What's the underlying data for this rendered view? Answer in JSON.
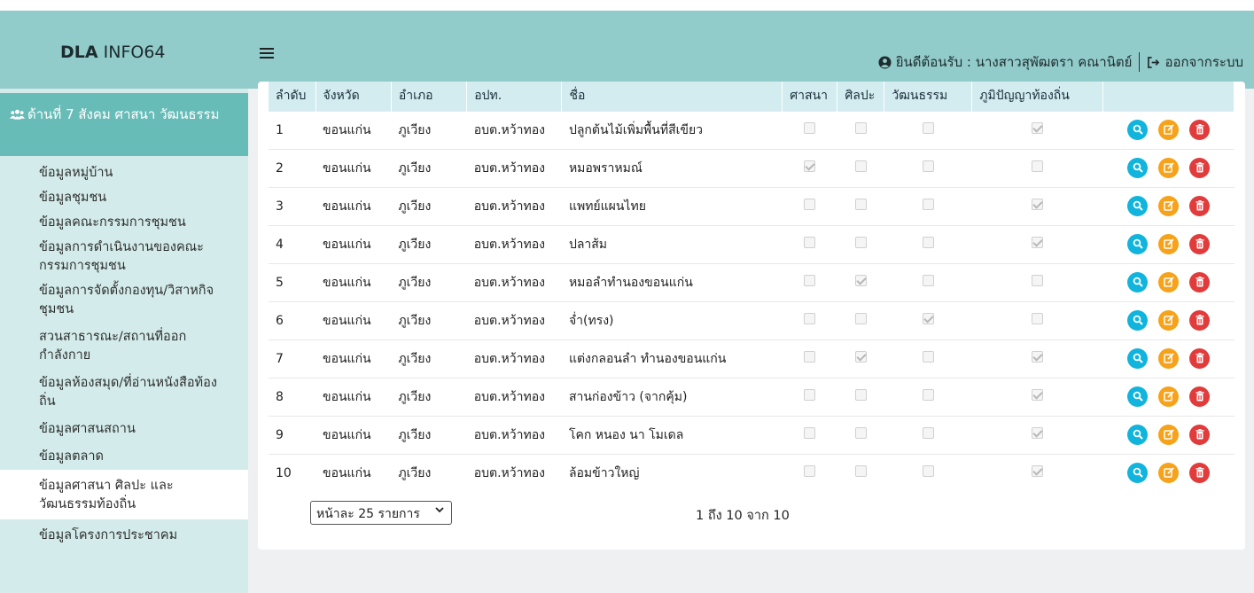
{
  "header": {
    "brand_bold": "DLA",
    "brand_rest": " INFO64",
    "welcome": "ยินดีต้อนรับ : นางสาวสุพัฒตรา คณานิตย์",
    "logout": "ออกจากระบบ",
    "bg_color": "#91cbca"
  },
  "sidebar": {
    "section_title": "ด้านที่ 7 สังคม ศาสนา วัฒนธรรม",
    "items": [
      {
        "label": "ข้อมูลหมู่บ้าน"
      },
      {
        "label": "ข้อมูลชุมชน"
      },
      {
        "label": "ข้อมูลคณะกรรมการชุมชน"
      },
      {
        "label": "ข้อมูลการดำเนินงานของคณะกรรมการชุมชน"
      },
      {
        "label": "ข้อมูลการจัดตั้งกองทุน/วิสาหกิจชุมชน"
      },
      {
        "label": "สวนสาธารณะ/สถานที่ออกกำลังกาย"
      },
      {
        "label": "ข้อมูลห้องสมุด/ที่อ่านหนังสือท้องถิ่น"
      },
      {
        "label": "ข้อมูลศาสนสถาน"
      },
      {
        "label": "ข้อมูลตลาด"
      },
      {
        "label": "ข้อมูลศาสนา ศิลปะ และวัฒนธรรมท้องถิ่น"
      },
      {
        "label": "ข้อมูลโครงการประชาคม"
      }
    ]
  },
  "table": {
    "columns": [
      "ลำดับ",
      "จังหวัด",
      "อำเภอ",
      "อปท.",
      "ชื่อ",
      "ศาสนา",
      "ศิลปะ",
      "วัฒนธรรม",
      "ภูมิปัญญาท้องถิ่น",
      ""
    ],
    "rows": [
      {
        "no": "1",
        "province": "ขอนแก่น",
        "district": "ภูเวียง",
        "org": "อบต.หว้าทอง",
        "name": "ปลูกต้นไม้เพิ่มพื้นที่สีเขียว",
        "religion": false,
        "art": false,
        "culture": false,
        "wisdom": true
      },
      {
        "no": "2",
        "province": "ขอนแก่น",
        "district": "ภูเวียง",
        "org": "อบต.หว้าทอง",
        "name": "หมอพราหมณ์",
        "religion": true,
        "art": false,
        "culture": false,
        "wisdom": false
      },
      {
        "no": "3",
        "province": "ขอนแก่น",
        "district": "ภูเวียง",
        "org": "อบต.หว้าทอง",
        "name": "แพทย์แผนไทย",
        "religion": false,
        "art": false,
        "culture": false,
        "wisdom": true
      },
      {
        "no": "4",
        "province": "ขอนแก่น",
        "district": "ภูเวียง",
        "org": "อบต.หว้าทอง",
        "name": "ปลาส้ม",
        "religion": false,
        "art": false,
        "culture": false,
        "wisdom": true
      },
      {
        "no": "5",
        "province": "ขอนแก่น",
        "district": "ภูเวียง",
        "org": "อบต.หว้าทอง",
        "name": "หมอลำทำนองขอนแก่น",
        "religion": false,
        "art": true,
        "culture": false,
        "wisdom": false
      },
      {
        "no": "6",
        "province": "ขอนแก่น",
        "district": "ภูเวียง",
        "org": "อบต.หว้าทอง",
        "name": "จ่ำ(ทรง)",
        "religion": false,
        "art": false,
        "culture": true,
        "wisdom": false
      },
      {
        "no": "7",
        "province": "ขอนแก่น",
        "district": "ภูเวียง",
        "org": "อบต.หว้าทอง",
        "name": "แต่งกลอนลำ ทำนองขอนแก่น",
        "religion": false,
        "art": true,
        "culture": false,
        "wisdom": true
      },
      {
        "no": "8",
        "province": "ขอนแก่น",
        "district": "ภูเวียง",
        "org": "อบต.หว้าทอง",
        "name": "สานก่องข้าว (จากคุ้ม)",
        "religion": false,
        "art": false,
        "culture": false,
        "wisdom": true
      },
      {
        "no": "9",
        "province": "ขอนแก่น",
        "district": "ภูเวียง",
        "org": "อบต.หว้าทอง",
        "name": "โคก หนอง นา โมเดล",
        "religion": false,
        "art": false,
        "culture": false,
        "wisdom": true
      },
      {
        "no": "10",
        "province": "ขอนแก่น",
        "district": "ภูเวียง",
        "org": "อบต.หว้าทอง",
        "name": "ล้อมข้าวใหญ่",
        "religion": false,
        "art": false,
        "culture": false,
        "wisdom": true
      }
    ]
  },
  "pagination": {
    "page_size": "หน้าละ 25 รายการ",
    "info": "1 ถึง 10 จาก 10"
  },
  "icons": {
    "view": "search-icon",
    "edit": "edit-icon",
    "delete": "trash-icon",
    "user": "user-circle-icon",
    "logout": "sign-out-icon",
    "menu": "hamburger-icon",
    "group": "users-icon"
  }
}
